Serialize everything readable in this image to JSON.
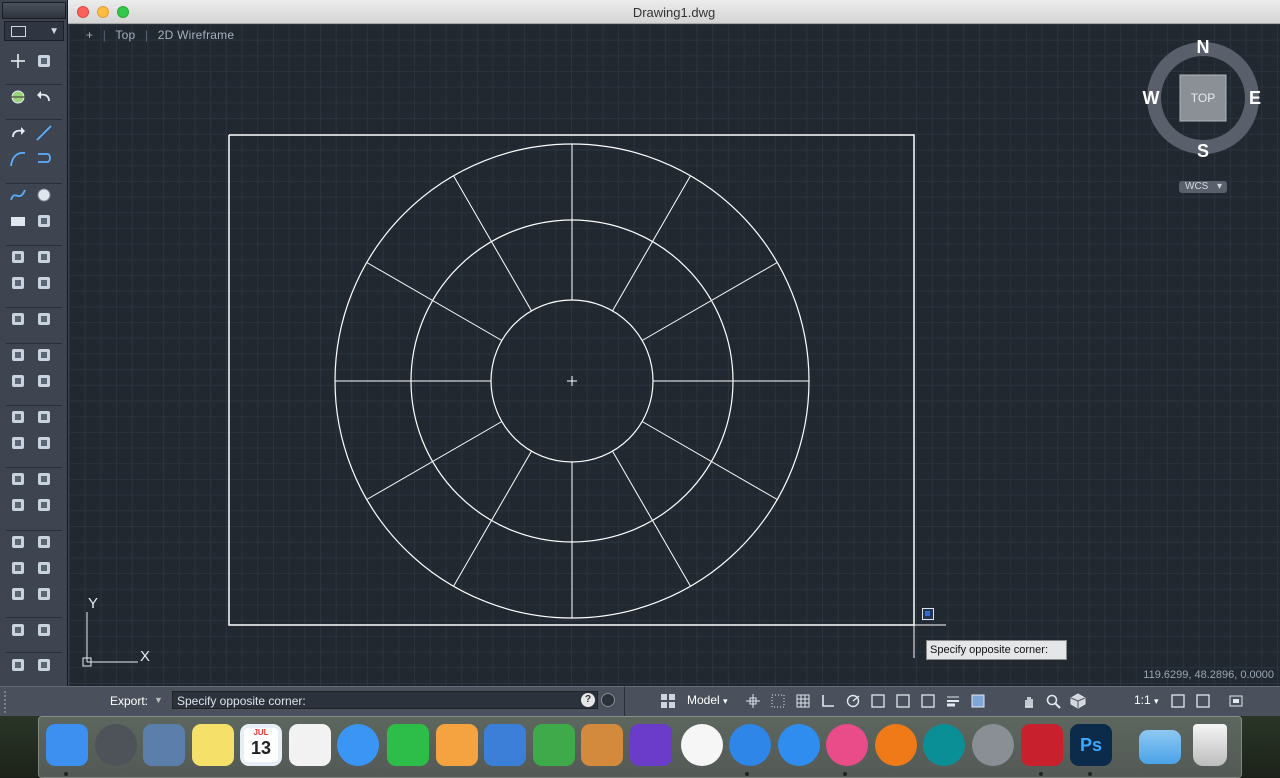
{
  "window": {
    "title": "Drawing1.dwg"
  },
  "viewport": {
    "view_menu": "+",
    "view_name": "Top",
    "visual_style": "2D Wireframe"
  },
  "navcube": {
    "north": "N",
    "south": "S",
    "east": "E",
    "west": "W",
    "face": "TOP",
    "ucs_menu": "WCS"
  },
  "ucs_icon": {
    "x_label": "X",
    "y_label": "Y"
  },
  "tooltip": {
    "text": "Specify opposite corner:"
  },
  "coordinates": {
    "text": "119.6299, 48.2896, 0.0000"
  },
  "command_line": {
    "label": "Export:",
    "prompt": "Specify opposite corner:",
    "help": "?"
  },
  "status_bar": {
    "space": "Model",
    "annotation_scale": "1:1"
  },
  "tool_palette": {
    "tools": [
      "select",
      "point",
      "snap-point",
      "undo",
      "redo",
      "line",
      "arc",
      "polyline",
      "spline",
      "circle",
      "rectangle",
      "donut",
      "region",
      "mirror-3d",
      "solid",
      "hatch",
      "pen",
      "layer",
      "eraser",
      "move",
      "rotate",
      "scale",
      "block",
      "combine",
      "array",
      "mirror",
      "offset",
      "break",
      "join",
      "fillet",
      "chamfer",
      "stretch",
      "view",
      "dimension-linear",
      "dimension-angle",
      "constraint",
      "edit",
      "measure",
      "distance",
      "zoom-window",
      "zoom-extents"
    ]
  },
  "dock": {
    "apps": [
      "Finder",
      "Launchpad",
      "Preview",
      "Notes",
      "Calendar",
      "Reminders",
      "Messages",
      "FaceTime",
      "Pages",
      "Keynote",
      "Numbers",
      "GarageBand",
      "iMovie",
      "Photos",
      "Safari",
      "App Store",
      "iTunes",
      "iBooks",
      "Arduino",
      "System Preferences",
      "AutoCAD",
      "Photoshop",
      "Downloads",
      "Trash"
    ],
    "calendar_month": "JUL",
    "calendar_day": "13",
    "photoshop_label": "Ps"
  },
  "colors": {
    "background": "#212830",
    "grid": "#2b333f",
    "geometry": "#ffffff",
    "accent": "#2f6bd9"
  }
}
